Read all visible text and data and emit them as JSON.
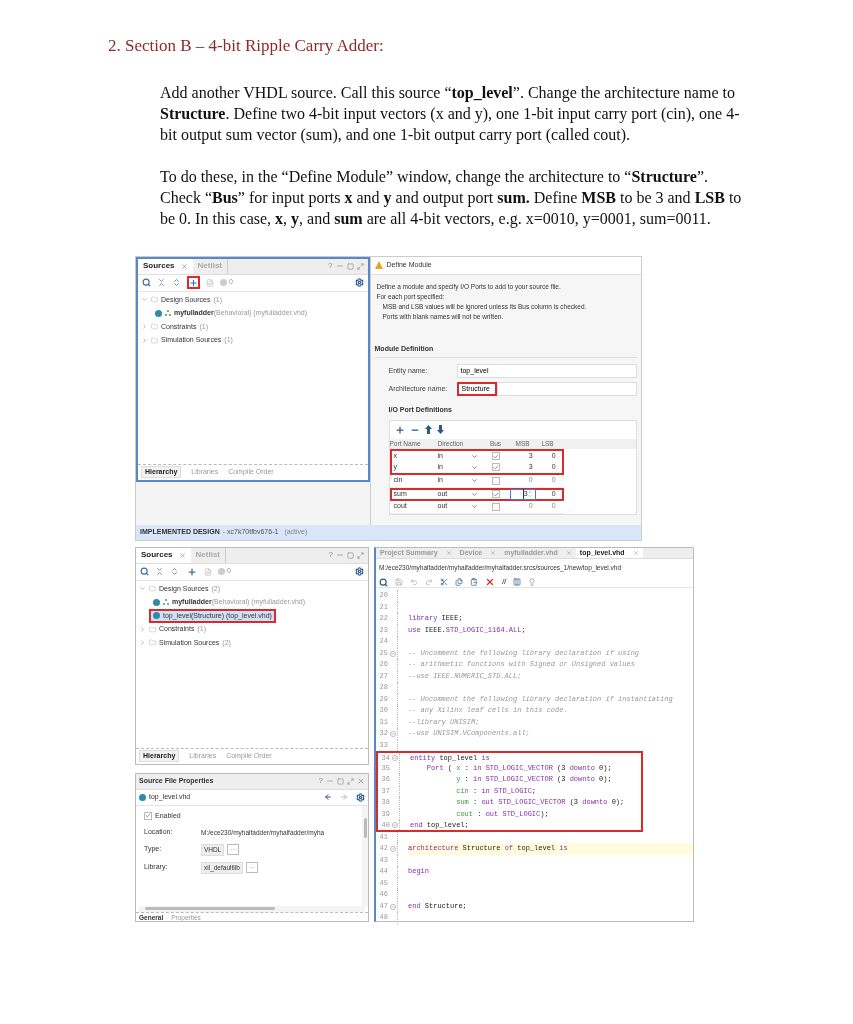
{
  "heading": "2. Section B – 4-bit Ripple Carry Adder:",
  "paragraphs": [
    "Add another VHDL source. Call this source “**top_level**”. Change the architecture name to **Structure**. Define two 4-bit input vectors (x and y), one 1-bit input carry port (cin), one 4-bit output sum vector (sum), and one 1-bit output carry port (called cout).",
    "To do these, in the “Define Module” window, change the architecture to “**Structure**”. Check “**Bus**” for input ports **x** and **y** and output port **sum.** Define **MSB** to be 3 and **LSB** to be 0. In this case, **x**, **y**, and **sum** are all 4-bit vectors, e.g. x=0010, y=0001, sum=0011."
  ],
  "figure_1": {
    "sources": {
      "tabs": [
        {
          "label": "Sources",
          "selected": true
        },
        {
          "label": "Netlist",
          "selected": false
        }
      ],
      "help": "?",
      "add_highlighted": true,
      "count": "0",
      "tree": [
        {
          "label": "Design Sources",
          "count": "(1)",
          "expanded": true,
          "children": [
            {
              "kind": "top",
              "name": "myfulladder",
              "detail": "(Behavioral) (myfulladder.vhd)",
              "selected": false,
              "highlighted": false
            }
          ]
        },
        {
          "label": "Constraints",
          "count": "(1)",
          "expanded": false
        },
        {
          "label": "Simulation Sources",
          "count": "(1)",
          "expanded": false
        }
      ],
      "bottom_tabs": [
        {
          "label": "Hierarchy",
          "selected": true
        },
        {
          "label": "Libraries",
          "selected": false
        },
        {
          "label": "Compile Order",
          "selected": false
        }
      ]
    },
    "status_bar": {
      "label": "IMPLEMENTED DESIGN",
      "part": "- xc7k70tfbv676-1",
      "state": "(active)"
    },
    "define_module": {
      "title": "Define Module",
      "intro": [
        "Define a module and specify I/O Ports to add to your source file.",
        "For each port specified:"
      ],
      "notes": [
        "MSB and LSB values will be ignored unless its Bus column is checked.",
        "Ports with blank names will not be written."
      ],
      "section": "Module Definition",
      "fields": [
        {
          "label": "Entity name:",
          "value": "top_level",
          "highlighted": false
        },
        {
          "label": "Architecture name:",
          "value": "Structure",
          "highlighted": true
        }
      ],
      "ports_title": "I/O Port Definitions",
      "columns": [
        "Port Name",
        "Direction",
        "Bus",
        "MSB",
        "LSB"
      ],
      "rows": [
        {
          "name": "x",
          "direction": "in",
          "bus": true,
          "msb": "3",
          "lsb": "0",
          "editing": false,
          "highlighted": true
        },
        {
          "name": "y",
          "direction": "in",
          "bus": true,
          "msb": "3",
          "lsb": "0",
          "editing": false,
          "highlighted": true
        },
        {
          "name": "cin",
          "direction": "in",
          "bus": false,
          "msb": "0",
          "lsb": "0",
          "editing": false,
          "highlighted": false
        },
        {
          "name": "sum",
          "direction": "out",
          "bus": true,
          "msb": "3",
          "lsb": "0",
          "editing": true,
          "highlighted": true
        },
        {
          "name": "cout",
          "direction": "out",
          "bus": false,
          "msb": "0",
          "lsb": "0",
          "editing": false,
          "highlighted": false
        }
      ]
    }
  },
  "figure_2": {
    "sources": {
      "tabs": [
        {
          "label": "Sources",
          "selected": true
        },
        {
          "label": "Netlist",
          "selected": false
        }
      ],
      "help": "?",
      "add_highlighted": false,
      "count": "0",
      "tree": [
        {
          "label": "Design Sources",
          "count": "(2)",
          "expanded": true,
          "children": [
            {
              "kind": "top",
              "name": "myfulladder",
              "detail": "(Behavioral) (myfulladder.vhd)",
              "selected": false,
              "highlighted": false
            },
            {
              "kind": "module",
              "name": "top_level",
              "detail": "(Structure) (top_level.vhd)",
              "selected": true,
              "highlighted": true
            }
          ]
        },
        {
          "label": "Constraints",
          "count": "(1)",
          "expanded": false
        },
        {
          "label": "Simulation Sources",
          "count": "(2)",
          "expanded": false
        }
      ],
      "bottom_tabs": [
        {
          "label": "Hierarchy",
          "selected": true
        },
        {
          "label": "Libraries",
          "selected": false
        },
        {
          "label": "Compile Order",
          "selected": false
        }
      ]
    },
    "properties": {
      "title": "Source File Properties",
      "help": "?",
      "file": "top_level.vhd",
      "enabled_label": "Enabled",
      "enabled": true,
      "rows": [
        {
          "kind": "text",
          "label": "Location:",
          "value": "M:/ece230/myhalfadder/myhalfadder/myha"
        },
        {
          "kind": "box",
          "label": "Type:",
          "value": "VHDL",
          "button": "···"
        },
        {
          "kind": "box",
          "label": "Library:",
          "value": "xil_defaultlib",
          "button": "···"
        }
      ],
      "bottom_tabs": [
        {
          "label": "General",
          "selected": true
        },
        {
          "label": "Properties",
          "selected": false
        }
      ]
    },
    "editor": {
      "tabs": [
        {
          "label": "Project Summary",
          "selected": false
        },
        {
          "label": "Device",
          "selected": false
        },
        {
          "label": "myfulladder.vhd",
          "selected": false
        },
        {
          "label": "top_level.vhd",
          "selected": true
        }
      ],
      "path": "M:/ece230/myhalfadder/myhalfadder/myhalfadder.srcs/sources_1/new/top_level.vhd",
      "comment_tool": "//",
      "lines": [
        {
          "n": "20",
          "fold": false,
          "boxed": false,
          "current": false
        },
        {
          "n": "21",
          "fold": false,
          "boxed": false,
          "current": false
        },
        {
          "n": "22",
          "fold": false,
          "boxed": false,
          "current": false,
          "code": [
            {
              "kind": "kw",
              "t": "library "
            },
            {
              "kind": "id",
              "t": "IEEE;"
            }
          ]
        },
        {
          "n": "23",
          "fold": false,
          "boxed": false,
          "current": false,
          "code": [
            {
              "kind": "kw",
              "t": "use "
            },
            {
              "kind": "id",
              "t": "IEEE."
            },
            {
              "kind": "kw",
              "t": "STD_LOGIC_1164.ALL"
            },
            {
              "kind": "id",
              "t": ";"
            }
          ]
        },
        {
          "n": "24",
          "fold": false,
          "boxed": false,
          "current": false
        },
        {
          "n": "25",
          "fold": true,
          "boxed": false,
          "current": false,
          "code": [
            {
              "kind": "comment",
              "t": "-- Uncomment the following library declaration if using"
            }
          ]
        },
        {
          "n": "26",
          "fold": false,
          "boxed": false,
          "current": false,
          "code": [
            {
              "kind": "comment",
              "t": "-- arithmetic functions with Signed or Unsigned values"
            }
          ]
        },
        {
          "n": "27",
          "fold": false,
          "boxed": false,
          "current": false,
          "code": [
            {
              "kind": "comment",
              "t": "--use IEEE.NUMERIC_STD.ALL;"
            }
          ]
        },
        {
          "n": "28",
          "fold": false,
          "boxed": false,
          "current": false
        },
        {
          "n": "29",
          "fold": false,
          "boxed": false,
          "current": false,
          "code": [
            {
              "kind": "comment",
              "t": "-- Uncomment the following library declaration if instantiating"
            }
          ]
        },
        {
          "n": "30",
          "fold": false,
          "boxed": false,
          "current": false,
          "code": [
            {
              "kind": "comment",
              "t": "-- any Xilinx leaf cells in this code."
            }
          ]
        },
        {
          "n": "31",
          "fold": false,
          "boxed": false,
          "current": false,
          "code": [
            {
              "kind": "comment",
              "t": "--library UNISIM;"
            }
          ]
        },
        {
          "n": "32",
          "fold": true,
          "boxed": false,
          "current": false,
          "code": [
            {
              "kind": "comment",
              "t": "--use UNISIM.VComponents.all;"
            }
          ]
        },
        {
          "n": "33",
          "fold": false,
          "boxed": false,
          "current": false
        },
        {
          "n": "34",
          "fold": true,
          "boxed": true,
          "current": false,
          "code": [
            {
              "kind": "kw",
              "t": "entity "
            },
            {
              "kind": "id",
              "t": "top_level "
            },
            {
              "kind": "kw",
              "t": "is"
            }
          ]
        },
        {
          "n": "35",
          "fold": false,
          "boxed": true,
          "current": false,
          "code": [
            {
              "kind": "kw",
              "t": "    Port "
            },
            {
              "kind": "id",
              "t": "( "
            },
            {
              "kind": "port",
              "t": "x "
            },
            {
              "kind": "id",
              "t": ": "
            },
            {
              "kind": "kw",
              "t": "in STD_LOGIC_VECTOR "
            },
            {
              "kind": "id",
              "t": "(3 "
            },
            {
              "kind": "kw",
              "t": "downto "
            },
            {
              "kind": "id",
              "t": "0);"
            }
          ]
        },
        {
          "n": "36",
          "fold": false,
          "boxed": true,
          "current": false,
          "code": [
            {
              "kind": "port",
              "t": "           y "
            },
            {
              "kind": "id",
              "t": ": "
            },
            {
              "kind": "kw",
              "t": "in STD_LOGIC_VECTOR "
            },
            {
              "kind": "id",
              "t": "(3 "
            },
            {
              "kind": "kw",
              "t": "downto "
            },
            {
              "kind": "id",
              "t": "0);"
            }
          ]
        },
        {
          "n": "37",
          "fold": false,
          "boxed": true,
          "current": false,
          "code": [
            {
              "kind": "port",
              "t": "           cin "
            },
            {
              "kind": "id",
              "t": ": "
            },
            {
              "kind": "kw",
              "t": "in STD_LOGIC"
            },
            {
              "kind": "id",
              "t": ";"
            }
          ]
        },
        {
          "n": "38",
          "fold": false,
          "boxed": true,
          "current": false,
          "code": [
            {
              "kind": "port",
              "t": "           sum "
            },
            {
              "kind": "id",
              "t": ": "
            },
            {
              "kind": "kw",
              "t": "out STD_LOGIC_VECTOR "
            },
            {
              "kind": "id",
              "t": "(3 "
            },
            {
              "kind": "kw",
              "t": "downto "
            },
            {
              "kind": "id",
              "t": "0);"
            }
          ]
        },
        {
          "n": "39",
          "fold": false,
          "boxed": true,
          "current": false,
          "code": [
            {
              "kind": "port",
              "t": "           cout "
            },
            {
              "kind": "id",
              "t": ": "
            },
            {
              "kind": "kw",
              "t": "out STD_LOGIC"
            },
            {
              "kind": "id",
              "t": ");"
            }
          ]
        },
        {
          "n": "40",
          "fold": true,
          "boxed": true,
          "current": false,
          "code": [
            {
              "kind": "kw",
              "t": "end "
            },
            {
              "kind": "id",
              "t": "top_level;"
            }
          ]
        },
        {
          "n": "41",
          "fold": false,
          "boxed": false,
          "current": false
        },
        {
          "n": "42",
          "fold": true,
          "boxed": false,
          "current": true,
          "code": [
            {
              "kind": "kw",
              "t": "architecture "
            },
            {
              "kind": "id",
              "t": "Structure "
            },
            {
              "kind": "kw",
              "t": "of "
            },
            {
              "kind": "id",
              "t": "top_level "
            },
            {
              "kind": "kw",
              "t": "is"
            }
          ]
        },
        {
          "n": "43",
          "fold": false,
          "boxed": false,
          "current": false
        },
        {
          "n": "44",
          "fold": false,
          "boxed": false,
          "current": false,
          "code": [
            {
              "kind": "kw",
              "t": "begin"
            }
          ]
        },
        {
          "n": "45",
          "fold": false,
          "boxed": false,
          "current": false
        },
        {
          "n": "46",
          "fold": false,
          "boxed": false,
          "current": false
        },
        {
          "n": "47",
          "fold": true,
          "boxed": false,
          "current": false,
          "code": [
            {
              "kind": "kw",
              "t": "end "
            },
            {
              "kind": "id",
              "t": "Structure;"
            }
          ]
        },
        {
          "n": "48",
          "fold": false,
          "boxed": false,
          "current": false
        }
      ]
    }
  }
}
